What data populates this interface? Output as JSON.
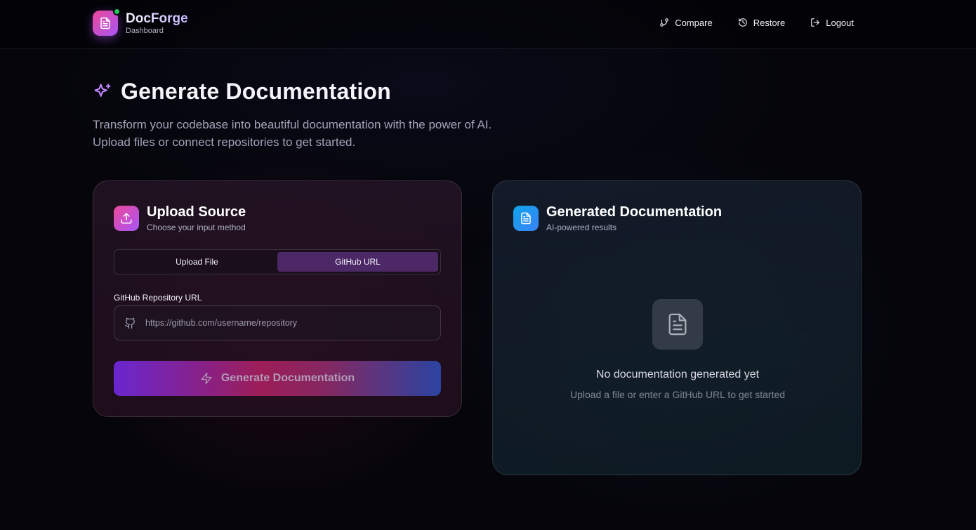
{
  "app": {
    "name": "DocForge",
    "subtitle": "Dashboard",
    "status_color": "#22c55e"
  },
  "nav": [
    {
      "label": "Compare",
      "icon": "git-compare-icon"
    },
    {
      "label": "Restore",
      "icon": "history-icon"
    },
    {
      "label": "Logout",
      "icon": "logout-icon"
    }
  ],
  "hero": {
    "icon": "sparkles-icon",
    "title": "Generate Documentation",
    "line1": "Transform your codebase into beautiful documentation with the power of AI.",
    "line2": "Upload files or connect repositories to get started."
  },
  "upload": {
    "icon": "upload-icon",
    "title": "Upload Source",
    "subtitle": "Choose your input method",
    "tabs": [
      {
        "label": "Upload File",
        "active": false
      },
      {
        "label": "GitHub URL",
        "active": true
      }
    ],
    "field_label": "GitHub Repository URL",
    "field_icon": "github-icon",
    "field_value": "",
    "field_placeholder": "https://github.com/username/repository",
    "button_label": "Generate Documentation",
    "button_icon": "zap-icon"
  },
  "result": {
    "icon": "file-text-icon",
    "title": "Generated Documentation",
    "subtitle": "AI-powered results",
    "empty_icon": "file-text-icon",
    "empty_title": "No documentation generated yet",
    "empty_subtitle": "Upload a file or enter a GitHub URL to get started"
  },
  "colors": {
    "accent_pink": "#ec4899",
    "accent_purple": "#a855f7",
    "accent_blue": "#3b82f6",
    "active_tab": "#4c2866"
  }
}
